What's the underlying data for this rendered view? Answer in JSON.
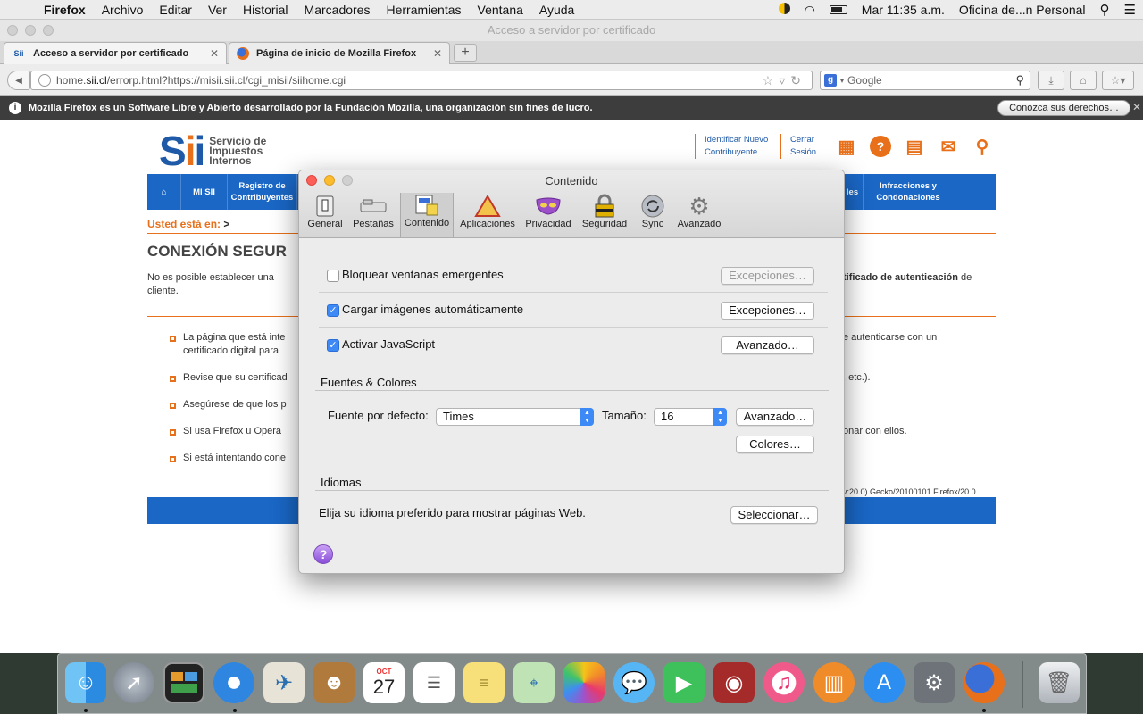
{
  "menubar": {
    "apple": "",
    "items": [
      "Firefox",
      "Archivo",
      "Editar",
      "Ver",
      "Historial",
      "Marcadores",
      "Herramientas",
      "Ventana",
      "Ayuda"
    ],
    "clock": "Mar 11:35 a.m.",
    "user": "Oficina de...n Personal"
  },
  "window": {
    "title": "Acceso a servidor por certificado"
  },
  "tabs": [
    {
      "label": "Acceso a servidor por certificado"
    },
    {
      "label": "Página de inicio de Mozilla Firefox"
    }
  ],
  "nav": {
    "url_prefix": "home.",
    "url_domain": "sii.cl",
    "url_rest": "/errorp.html?https://misii.sii.cl/cgi_misii/siihome.cgi",
    "search_engine_icon": "g",
    "search_placeholder": "Google"
  },
  "infobar": {
    "text": "Mozilla Firefox es un Software Libre y Abierto desarrollado por la Fundación Mozilla, una organización sin fines de lucro.",
    "button": "Conozca sus derechos…"
  },
  "site": {
    "logo_text": [
      "Servicio de",
      "Impuestos",
      "Internos"
    ],
    "link_identificar": [
      "Identificar Nuevo",
      "Contribuyente"
    ],
    "link_cerrar": [
      "Cerrar",
      "Sesión"
    ],
    "nav_items": [
      "MI SII",
      "Registro de Contribuyentes",
      "s",
      "les",
      "Infracciones y Condonaciones"
    ],
    "breadcrumb_label": "Usted está en:",
    "breadcrumb_arrow": ">",
    "heading": "CONEXIÓN SEGUR",
    "intro_left": "No es posible establecer una",
    "intro_left2": "cliente.",
    "intro_right_bold": "tificado de autenticación",
    "intro_right_tail": "de",
    "bullets_left": [
      "La página que está inte",
      "Revise que su certificad",
      "Asegúrese de que los p",
      "Si usa Firefox u Opera",
      "Si está intentando cone"
    ],
    "bullet1_line2": "certificado digital para",
    "bullets_right": [
      "e autenticarse con un",
      ", etc.).",
      "",
      "onar con ellos.",
      ""
    ],
    "useragent": "v:20.0) Gecko/20100101 Firefox/20.0"
  },
  "dialog": {
    "title": "Contenido",
    "toolbar": [
      "General",
      "Pestañas",
      "Contenido",
      "Aplicaciones",
      "Privacidad",
      "Seguridad",
      "Sync",
      "Avanzado"
    ],
    "selected_tab": "Contenido",
    "popup_label": "Bloquear ventanas emergentes",
    "popup_checked": false,
    "images_label": "Cargar imágenes automáticamente",
    "images_checked": true,
    "js_label": "Activar JavaScript",
    "js_checked": true,
    "exceptions_btn": "Excepciones…",
    "advanced_btn": "Avanzado…",
    "fonts_section": "Fuentes & Colores",
    "default_font_label": "Fuente por defecto:",
    "default_font_value": "Times",
    "size_label": "Tamaño:",
    "size_value": "16",
    "colors_btn": "Colores…",
    "lang_section": "Idiomas",
    "lang_text": "Elija su idioma preferido para mostrar páginas Web.",
    "select_btn": "Seleccionar…",
    "help": "?"
  },
  "dock": [
    "finder-icon",
    "launchpad-icon",
    "mission-control-icon",
    "safari-icon",
    "mail-icon",
    "contacts-icon",
    "calendar-icon",
    "reminders-icon",
    "notes-icon",
    "maps-icon",
    "photos-icon",
    "messages-icon",
    "facetime-icon",
    "photo-booth-icon",
    "itunes-icon",
    "ibooks-icon",
    "app-store-icon",
    "system-preferences-icon",
    "firefox-icon",
    "trash-icon"
  ],
  "calendar": {
    "month": "OCT",
    "day": "27"
  }
}
